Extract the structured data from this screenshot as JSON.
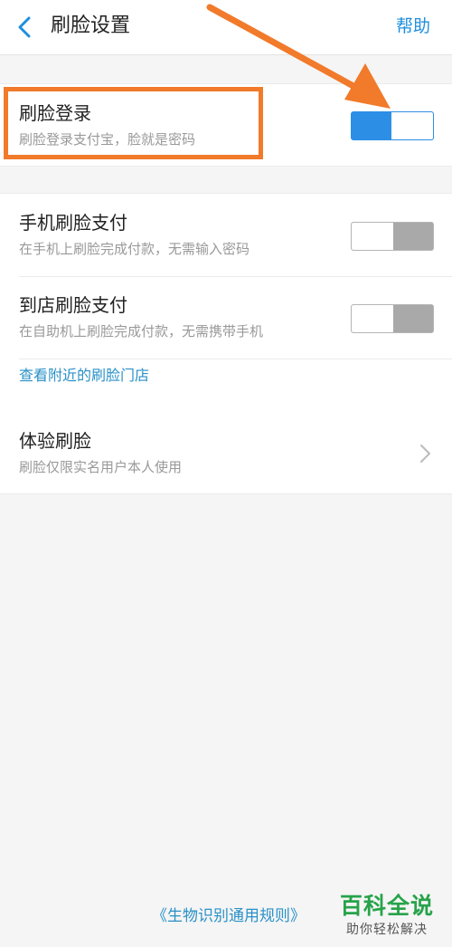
{
  "header": {
    "title": "刷脸设置",
    "help": "帮助"
  },
  "settings": {
    "face_login": {
      "title": "刷脸登录",
      "subtitle": "刷脸登录支付宝，脸就是密码",
      "enabled": true
    },
    "phone_pay": {
      "title": "手机刷脸支付",
      "subtitle": "在手机上刷脸完成付款，无需输入密码",
      "enabled": false
    },
    "store_pay": {
      "title": "到店刷脸支付",
      "subtitle": "在自助机上刷脸完成付款，无需携带手机",
      "enabled": false
    },
    "nearby_link": "查看附近的刷脸门店",
    "experience": {
      "title": "体验刷脸",
      "subtitle": "刷脸仅限实名用户本人使用"
    }
  },
  "footer": {
    "rules_link": "《生物识别通用规则》"
  },
  "watermark": {
    "main": "百科全说",
    "sub": "助你轻松解决"
  },
  "colors": {
    "accent": "#2d8ee6",
    "link": "#2a91c7",
    "annotation": "#f17a2b",
    "watermark": "#27a34a"
  },
  "icons": {
    "back": "chevron-left-icon",
    "row_arrow": "chevron-right-icon"
  }
}
